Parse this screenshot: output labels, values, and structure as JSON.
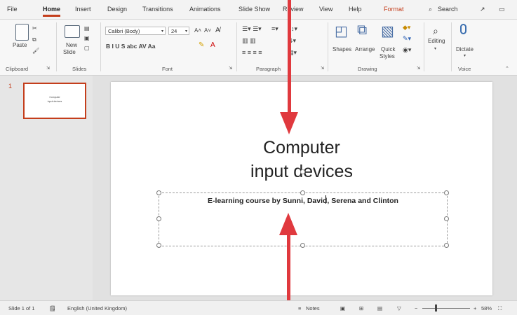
{
  "tabs": [
    "File",
    "Home",
    "Insert",
    "Design",
    "Transitions",
    "Animations",
    "Slide Show",
    "Review",
    "View",
    "Help",
    "Format"
  ],
  "tab_search": "Search",
  "ribbon": {
    "clipboard": {
      "label": "Clipboard",
      "paste": "Paste"
    },
    "slides": {
      "label": "Slides",
      "new_slide": "New",
      "new_slide2": "Slide"
    },
    "font": {
      "label": "Font",
      "name": "Calibri (Body)",
      "size": "24",
      "styles": "B  I  U  S  abc  AV  Aa"
    },
    "paragraph": {
      "label": "Paragraph"
    },
    "drawing": {
      "label": "Drawing",
      "shapes": "Shapes",
      "arrange": "Arrange",
      "quick": "Quick",
      "styles": "Styles"
    },
    "editing": {
      "label": "Editing"
    },
    "voice": {
      "label": "Voice",
      "dictate": "Dictate"
    }
  },
  "thumbnail": {
    "number": "1",
    "line1": "Computer",
    "line2": "input devices"
  },
  "slide": {
    "title_line1": "Computer",
    "title_line2": "input devices",
    "subtitle": "E-learning course by Sunni, David, Serena and Clinton"
  },
  "status": {
    "slide_count": "Slide 1 of 1",
    "language": "English (United Kingdom)",
    "notes": "Notes",
    "zoom": "58%"
  },
  "colors": {
    "accent": "#c43e1c",
    "arrow": "#e0393e"
  }
}
